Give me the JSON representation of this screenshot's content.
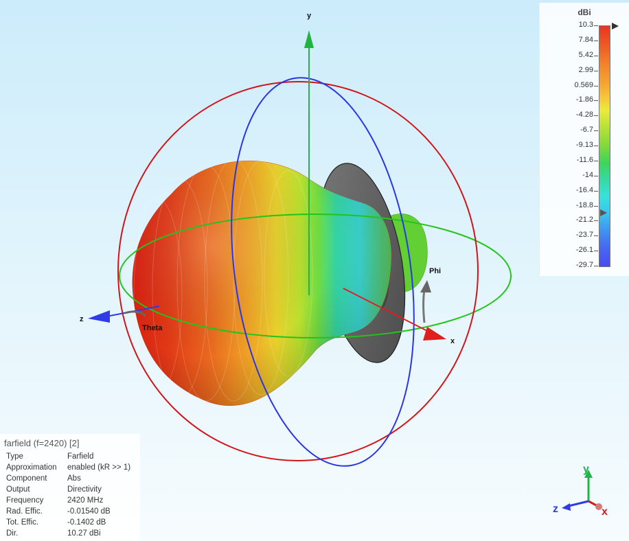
{
  "scene": {
    "axes": {
      "x": "x",
      "y": "y",
      "z": "z"
    },
    "angles": {
      "theta": "Theta",
      "phi": "Phi"
    },
    "triad": {
      "x": "x",
      "y": "y",
      "z": "z"
    },
    "colors": {
      "x_axis": "#e01e1e",
      "y_axis": "#22b34a",
      "z_axis": "#2f3ae8",
      "background": "#d7f0fb"
    }
  },
  "legend": {
    "unit": "dBi",
    "ticks": [
      "10.3",
      "7.84",
      "5.42",
      "2.99",
      "0.569",
      "-1.86",
      "-4.28",
      "-6.7",
      "-9.13",
      "-11.6",
      "-14",
      "-16.4",
      "-18.8",
      "-21.2",
      "-23.7",
      "-26.1",
      "-29.7"
    ],
    "markers": [
      "10.3",
      "-21.2"
    ]
  },
  "info": {
    "title": "farfield (f=2420) [2]",
    "rows": [
      {
        "label": "Type",
        "value": "Farfield"
      },
      {
        "label": "Approximation",
        "value": "enabled (kR >> 1)"
      },
      {
        "label": "Component",
        "value": "Abs"
      },
      {
        "label": "Output",
        "value": "Directivity"
      },
      {
        "label": "Frequency",
        "value": "2420 MHz"
      },
      {
        "label": "Rad. Effic.",
        "value": "-0.01540 dB"
      },
      {
        "label": "Tot. Effic.",
        "value": "-0.1402 dB"
      },
      {
        "label": "Dir.",
        "value": "10.27 dBi"
      }
    ]
  }
}
